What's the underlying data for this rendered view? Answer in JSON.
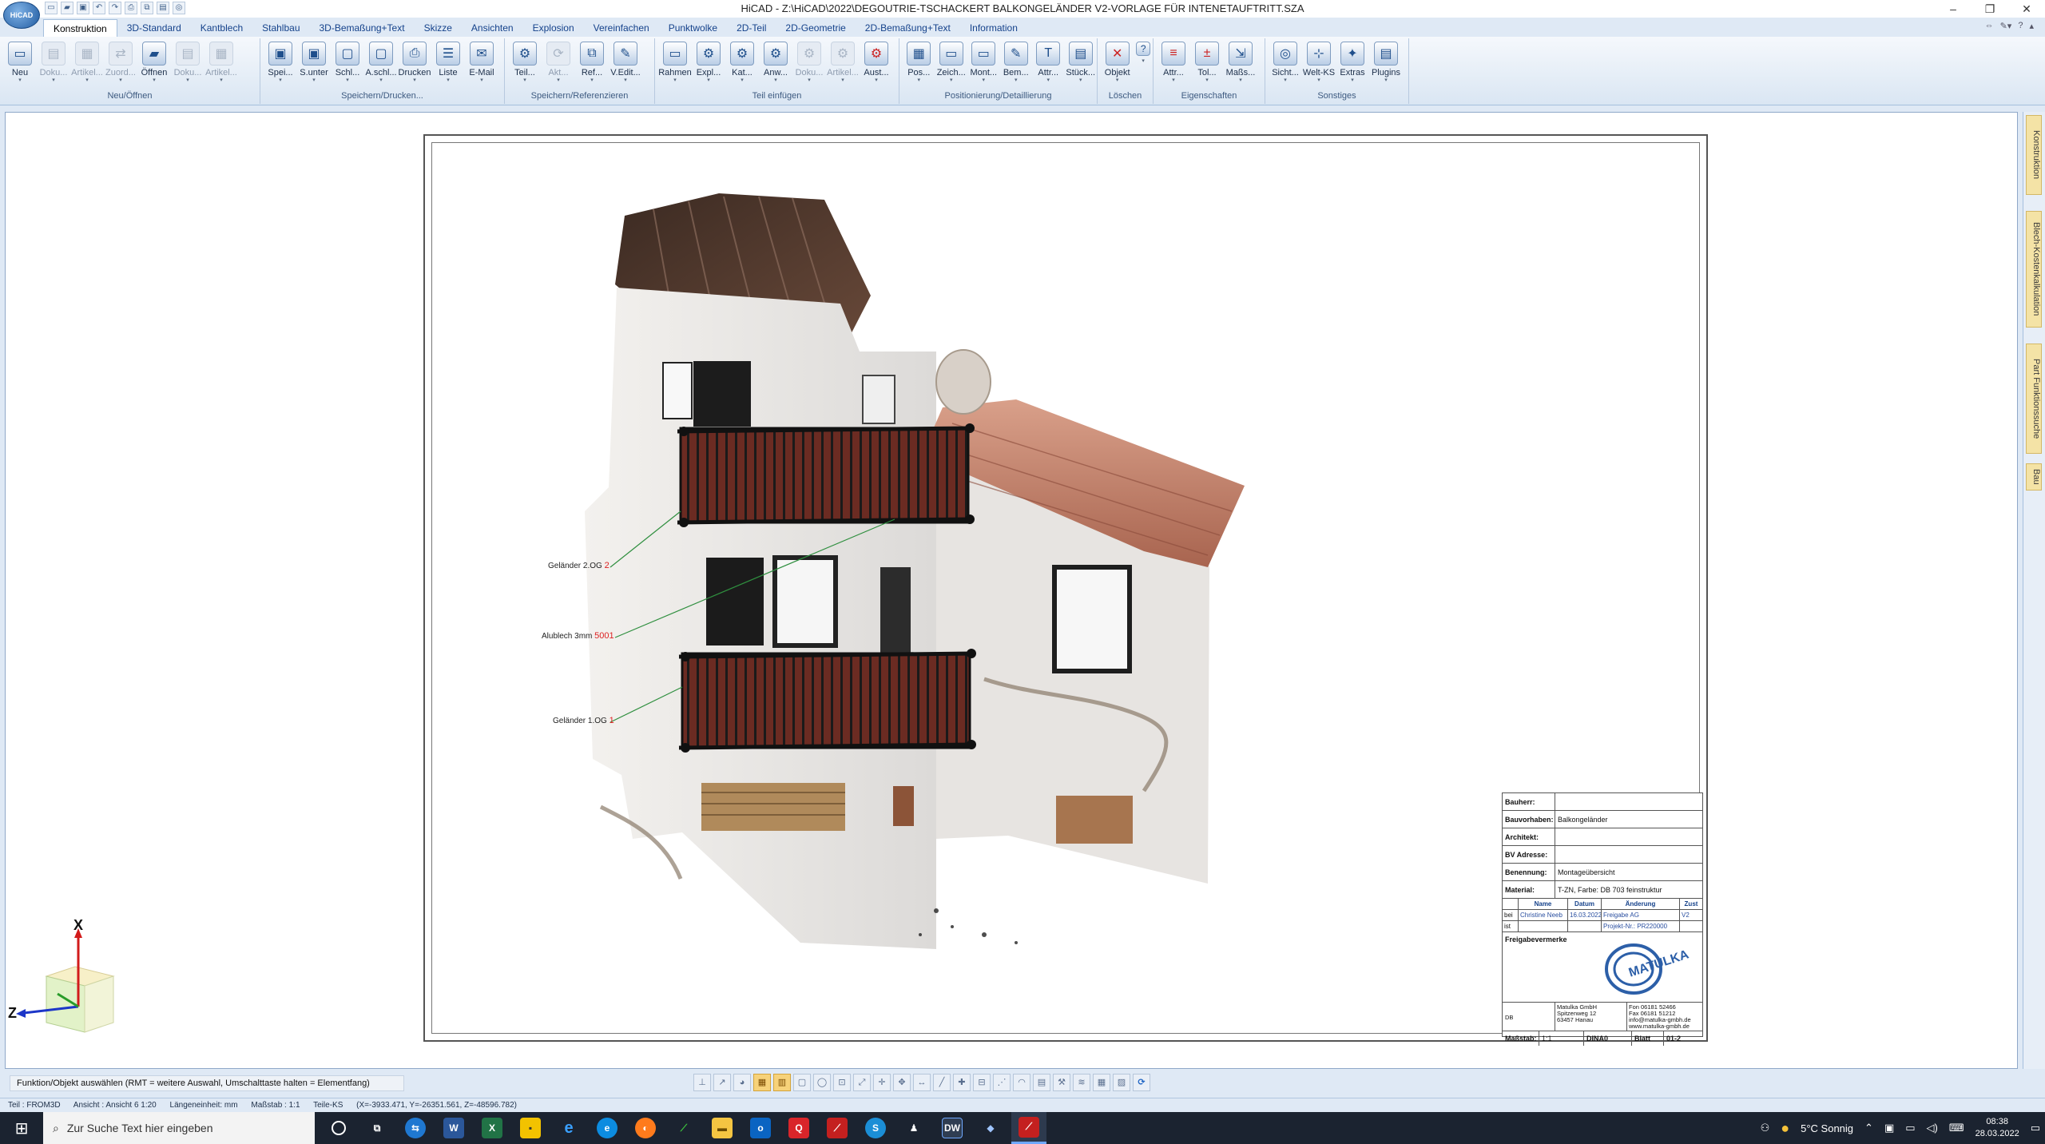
{
  "window": {
    "title": "HiCAD - Z:\\HiCAD\\2022\\DEGOUTRIE-TSCHACKERT BALKONGELÄNDER V2-VORLAGE FÜR INTENETAUFTRITT.SZA",
    "app_button": "HiCAD",
    "minimize": "–",
    "restore": "❐",
    "close": "✕"
  },
  "tabs": [
    {
      "label": "Konstruktion",
      "active": true
    },
    {
      "label": "3D-Standard"
    },
    {
      "label": "Kantblech"
    },
    {
      "label": "Stahlbau"
    },
    {
      "label": "3D-Bemaßung+Text"
    },
    {
      "label": "Skizze"
    },
    {
      "label": "Ansichten"
    },
    {
      "label": "Explosion"
    },
    {
      "label": "Vereinfachen"
    },
    {
      "label": "Punktwolke"
    },
    {
      "label": "2D-Teil"
    },
    {
      "label": "2D-Geometrie"
    },
    {
      "label": "2D-Bemaßung+Text"
    },
    {
      "label": "Information"
    }
  ],
  "ribbon_groups": [
    {
      "title": "Neu/Öffnen",
      "buttons": [
        {
          "label": "Neu",
          "icon": "new-doc-icon",
          "glyph": "▭"
        },
        {
          "label": "Doku...",
          "icon": "doc-icon",
          "glyph": "▤",
          "dim": true
        },
        {
          "label": "Artikel...",
          "icon": "article-icon",
          "glyph": "▦",
          "dim": true
        },
        {
          "label": "Zuord...",
          "icon": "assign-icon",
          "glyph": "⇄",
          "dim": true
        },
        {
          "label": "Öffnen",
          "icon": "open-folder-icon",
          "glyph": "▰"
        },
        {
          "label": "Doku...",
          "icon": "doc-icon",
          "glyph": "▤",
          "dim": true
        },
        {
          "label": "Artikel...",
          "icon": "article-icon",
          "glyph": "▦",
          "dim": true
        }
      ]
    },
    {
      "title": "Speichern/Drucken...",
      "buttons": [
        {
          "label": "Spei...",
          "icon": "save-icon",
          "glyph": "▣"
        },
        {
          "label": "S.unter",
          "icon": "save-as-icon",
          "glyph": "▣"
        },
        {
          "label": "Schl...",
          "icon": "close-doc-icon",
          "glyph": "▢"
        },
        {
          "label": "A.schl...",
          "icon": "close-all-icon",
          "glyph": "▢"
        },
        {
          "label": "Drucken",
          "icon": "print-icon",
          "glyph": "⎙"
        },
        {
          "label": "Liste",
          "icon": "list-icon",
          "glyph": "☰"
        },
        {
          "label": "E-Mail",
          "icon": "email-icon",
          "glyph": "✉"
        }
      ]
    },
    {
      "title": "Speichern/Referenzieren",
      "buttons": [
        {
          "label": "Teil...",
          "icon": "part-icon",
          "glyph": "⚙"
        },
        {
          "label": "Akt...",
          "icon": "update-icon",
          "glyph": "⟳",
          "dim": true
        },
        {
          "label": "Ref...",
          "icon": "reference-icon",
          "glyph": "⧉"
        },
        {
          "label": "V.Edit...",
          "icon": "edit-icon",
          "glyph": "✎"
        }
      ]
    },
    {
      "title": "Teil einfügen",
      "buttons": [
        {
          "label": "Rahmen",
          "icon": "frame-icon",
          "glyph": "▭"
        },
        {
          "label": "Expl...",
          "icon": "explorer-icon",
          "glyph": "⚙"
        },
        {
          "label": "Kat...",
          "icon": "catalog-icon",
          "glyph": "⚙"
        },
        {
          "label": "Anw...",
          "icon": "apply-icon",
          "glyph": "⚙"
        },
        {
          "label": "Doku...",
          "icon": "doc-icon",
          "glyph": "⚙",
          "dim": true
        },
        {
          "label": "Artikel...",
          "icon": "article-icon",
          "glyph": "⚙",
          "dim": true
        },
        {
          "label": "Aust...",
          "icon": "exchange-icon",
          "glyph": "⚙",
          "red": true
        }
      ]
    },
    {
      "title": "Positionierung/Detaillierung",
      "buttons": [
        {
          "label": "Pos...",
          "icon": "position-icon",
          "glyph": "▦"
        },
        {
          "label": "Zeich...",
          "icon": "drawing-icon",
          "glyph": "▭"
        },
        {
          "label": "Mont...",
          "icon": "assembly-icon",
          "glyph": "▭"
        },
        {
          "label": "Bem...",
          "icon": "dimension-icon",
          "glyph": "✎"
        },
        {
          "label": "Attr...",
          "icon": "attribute-text-icon",
          "glyph": "T"
        },
        {
          "label": "Stück...",
          "icon": "parts-list-icon",
          "glyph": "▤"
        }
      ]
    },
    {
      "title": "Löschen",
      "buttons": [
        {
          "label": "Objekt",
          "icon": "delete-x-icon",
          "glyph": "✕",
          "red": true
        },
        {
          "label": "",
          "icon": "help-icon",
          "glyph": "?",
          "small": true
        }
      ]
    },
    {
      "title": "Eigenschaften",
      "buttons": [
        {
          "label": "Attr...",
          "icon": "attributes-icon",
          "glyph": "≡",
          "red": true
        },
        {
          "label": "Tol...",
          "icon": "tolerance-icon",
          "glyph": "±",
          "red": true
        },
        {
          "label": "Maßs...",
          "icon": "scale-icon",
          "glyph": "⇲"
        }
      ]
    },
    {
      "title": "Sonstiges",
      "buttons": [
        {
          "label": "Sicht...",
          "icon": "view-icon",
          "glyph": "◎"
        },
        {
          "label": "Welt-KS",
          "icon": "world-coords-icon",
          "glyph": "⊹"
        },
        {
          "label": "Extras",
          "icon": "extras-icon",
          "glyph": "✦"
        },
        {
          "label": "Plugins",
          "icon": "plugins-icon",
          "glyph": "▤"
        }
      ]
    }
  ],
  "right_panel": [
    "Konstruktion",
    "Blech-Kostenkalkulation",
    "Part Funktionssuche",
    "Bau"
  ],
  "callouts": [
    {
      "text": "Geländer 2.OG",
      "num": "2"
    },
    {
      "text": "Alublech 3mm",
      "num": "5001"
    },
    {
      "text": "Geländer 1.OG",
      "num": "1"
    }
  ],
  "titleblock": {
    "rows": [
      {
        "key": "Bauherr:",
        "value": ""
      },
      {
        "key": "Bauvorhaben:",
        "value": "Balkongeländer"
      },
      {
        "key": "Architekt:",
        "value": ""
      },
      {
        "key": "BV Adresse:",
        "value": ""
      },
      {
        "key": "Benennung:",
        "value": "Montageübersicht"
      },
      {
        "key": "Material:",
        "value": "T-ZN, Farbe: DB 703 feinstruktur"
      }
    ],
    "header": {
      "name": "Name",
      "datum": "Datum",
      "aenderung": "Änderung",
      "zust": "Zust"
    },
    "rev1": {
      "mark": "bei",
      "name": "Christine Neeb",
      "datum": "16.03.2022",
      "aenderung": "Freigabe AG",
      "zust": "V2"
    },
    "rev2": {
      "mark": "ist",
      "name": "",
      "datum": "",
      "aenderung": "Projekt-Nr.: PR220000",
      "zust": ""
    },
    "release_label": "Freigabevermerke",
    "logo_text": "MATULKA",
    "company_key": "DB",
    "company_addr": [
      "Matulka GmbH",
      "Spitzenweg 12",
      "63457 Hanau"
    ],
    "company_contact": [
      "Fon 06181 52466",
      "Fax 06181 51212",
      "info@matulka-gmbh.de",
      "www.matulka-gmbh.de"
    ],
    "scale_label": "Maßstab:",
    "scale_value": "1:1",
    "format": "DINA0",
    "sheet": "Blatt",
    "sheet_value": "01-2"
  },
  "triad": {
    "x": "X",
    "z": "Z"
  },
  "prompt": "Funktion/Objekt auswählen (RMT = weitere Auswahl, Umschalttaste halten = Elementfang)",
  "statusbar": [
    "Teil : FROM3D",
    "Ansicht : Ansicht 6 1:20",
    "Längeneinheit: mm",
    "Maßstab : 1:1",
    "Teile-KS",
    "(X=-3933.471, Y=-26351.561, Z=-48596.782)"
  ],
  "taskbar": {
    "search_placeholder": "Zur Suche Text hier eingeben",
    "weather": "5°C Sonnig",
    "time": "08:38",
    "date": "28.03.2022"
  },
  "colors": {
    "ribbon_bg": "#dfe9f5",
    "accent": "#15428b",
    "callout_num": "#dd2222",
    "taskbar": "#1b2330"
  }
}
